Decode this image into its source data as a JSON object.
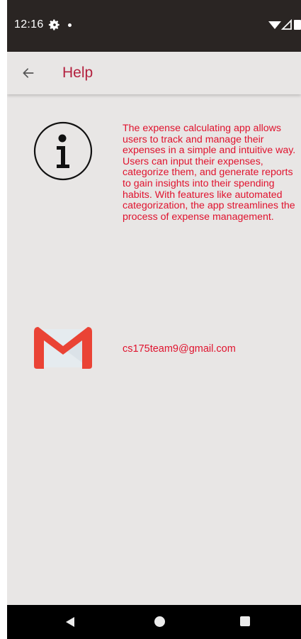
{
  "status_bar": {
    "time": "12:16",
    "icons": [
      "gear-icon",
      "notification-dot-icon",
      "wifi-icon",
      "signal-icon",
      "battery-icon"
    ]
  },
  "app_bar": {
    "back_icon": "arrow-left-icon",
    "title": "Help",
    "title_color": "#b3213f"
  },
  "content": {
    "info_icon": "info-circle-icon",
    "description": "The expense calculating app allows users to track and manage their expenses in a simple and intuitive way. Users can input their expenses, categorize them, and generate reports to gain insights into their spending habits. With features like automated categorization, the app streamlines the process of expense management.",
    "mail_icon": "gmail-icon",
    "email": "cs175team9@gmail.com",
    "text_color": "#e0132e"
  },
  "nav_bar": {
    "icons": [
      "nav-back-icon",
      "nav-home-icon",
      "nav-recents-icon"
    ]
  }
}
